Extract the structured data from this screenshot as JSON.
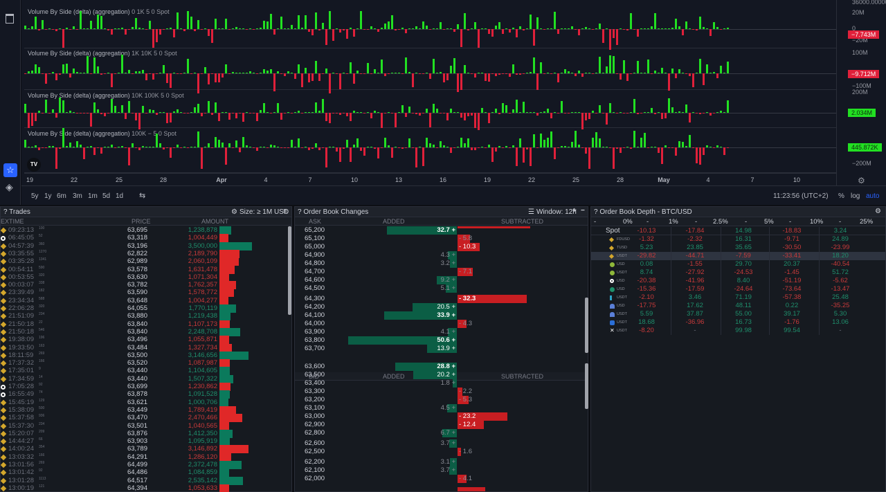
{
  "chart": {
    "panes": [
      {
        "title": "Volume By Side (delta) (aggregation)",
        "params": "0 1K 5 0 Spot",
        "axis": [
          "20M",
          "0",
          "−20M"
        ],
        "last": "−7.743M",
        "last_side": "sell"
      },
      {
        "title": "Volume By Side (delta) (aggregation)",
        "params": "1K 10K 5 0 Spot",
        "axis": [
          "100M",
          "−100M"
        ],
        "last": "−9.712M",
        "last_side": "sell"
      },
      {
        "title": "Volume By Side (delta) (aggregation)",
        "params": "10K 100K 5 0 Spot",
        "axis": [
          "200M"
        ],
        "last": "2.034M",
        "last_side": "buy"
      },
      {
        "title": "Volume By Side (delta) (aggregation)",
        "params": "100K − 5 0 Spot",
        "axis": [
          "−200M"
        ],
        "last": "445.872K",
        "last_side": "buy"
      }
    ],
    "top_axis_value": "36000.00000",
    "time_labels": [
      "19",
      "22",
      "25",
      "28",
      "Apr",
      "4",
      "7",
      "10",
      "13",
      "16",
      "19",
      "22",
      "25",
      "28",
      "May",
      "4",
      "7",
      "10"
    ],
    "ranges": [
      "5y",
      "1y",
      "6m",
      "3m",
      "1m",
      "5d",
      "1d"
    ],
    "clock": "11:23:56 (UTC+2)",
    "pct": "%",
    "log": "log",
    "auto": "auto",
    "logo": "TV"
  },
  "trades": {
    "title": "? Trades",
    "size_filter": "Size: ≥ 1M USD",
    "columns": [
      "EXTIME",
      "PRICE",
      "AMOUNT"
    ],
    "rows": [
      {
        "ex": "binance",
        "time": "09:23:13",
        "ms": "100",
        "price": "63,695",
        "amount": "1,238,878",
        "side": "buy",
        "v": 1.24
      },
      {
        "ex": "coinbase",
        "time": "06:45:05",
        "ms": "52",
        "price": "63,318",
        "amount": "1,004,449",
        "side": "sell",
        "v": 1.0
      },
      {
        "ex": "binance",
        "time": "04:57:39",
        "ms": "360",
        "price": "63,196",
        "amount": "3,500,000",
        "side": "buy",
        "v": 3.5
      },
      {
        "ex": "binance",
        "time": "03:35:55",
        "ms": "1270",
        "price": "62,822",
        "amount": "2,189,790",
        "side": "sell",
        "v": 2.19
      },
      {
        "ex": "binance",
        "time": "03:35:28",
        "ms": "1341",
        "price": "62,989",
        "amount": "2,060,109",
        "side": "sell",
        "v": 2.06
      },
      {
        "ex": "binance",
        "time": "00:54:11",
        "ms": "590",
        "price": "63,578",
        "amount": "1,631,478",
        "side": "sell",
        "v": 1.63
      },
      {
        "ex": "binance",
        "time": "00:53:55",
        "ms": "320",
        "price": "63,630",
        "amount": "1,071,304",
        "side": "sell",
        "v": 1.07
      },
      {
        "ex": "binance",
        "time": "00:03:07",
        "ms": "338",
        "price": "63,782",
        "amount": "1,762,357",
        "side": "sell",
        "v": 1.76
      },
      {
        "ex": "binance",
        "time": "23:39:49",
        "ms": "182",
        "price": "63,590",
        "amount": "1,578,772",
        "side": "sell",
        "v": 1.58
      },
      {
        "ex": "binance",
        "time": "23:34:34",
        "ms": "588",
        "price": "63,648",
        "amount": "1,004,277",
        "side": "sell",
        "v": 1.0
      },
      {
        "ex": "binance",
        "time": "22:06:28",
        "ms": "320",
        "price": "64,055",
        "amount": "1,770,119",
        "side": "buy",
        "v": 1.77
      },
      {
        "ex": "binance",
        "time": "21:51:09",
        "ms": "234",
        "price": "63,880",
        "amount": "1,219,438",
        "side": "buy",
        "v": 1.22
      },
      {
        "ex": "binance",
        "time": "21:50:18",
        "ms": "22",
        "price": "63,840",
        "amount": "1,107,173",
        "side": "sell",
        "v": 1.11
      },
      {
        "ex": "binance",
        "time": "21:50:18",
        "ms": "546",
        "price": "63,840",
        "amount": "2,248,708",
        "side": "buy",
        "v": 2.25
      },
      {
        "ex": "binance",
        "time": "19:38:09",
        "ms": "196",
        "price": "63,496",
        "amount": "1,055,871",
        "side": "sell",
        "v": 1.06
      },
      {
        "ex": "binance",
        "time": "19:33:50",
        "ms": "163",
        "price": "63,484",
        "amount": "1,327,734",
        "side": "sell",
        "v": 1.33
      },
      {
        "ex": "binance",
        "time": "18:11:59",
        "ms": "269",
        "price": "63,500",
        "amount": "3,146,656",
        "side": "buy",
        "v": 3.15
      },
      {
        "ex": "binance",
        "time": "17:37:32",
        "ms": "166",
        "price": "63,520",
        "amount": "1,087,987",
        "side": "sell",
        "v": 1.09
      },
      {
        "ex": "binance",
        "time": "17:35:01",
        "ms": "9",
        "price": "63,440",
        "amount": "1,104,605",
        "side": "buy",
        "v": 1.1
      },
      {
        "ex": "binance",
        "time": "17:34:59",
        "ms": "14",
        "price": "63,440",
        "amount": "1,507,322",
        "side": "buy",
        "v": 1.51
      },
      {
        "ex": "coinbase",
        "time": "17:05:28",
        "ms": "92",
        "price": "63,699",
        "amount": "1,230,862",
        "side": "sell",
        "v": 1.23
      },
      {
        "ex": "coinbase",
        "time": "16:55:49",
        "ms": "74",
        "price": "63,878",
        "amount": "1,091,528",
        "side": "buy",
        "v": 1.09
      },
      {
        "ex": "binance",
        "time": "15:45:19",
        "ms": "129",
        "price": "63,621",
        "amount": "1,000,706",
        "side": "buy",
        "v": 1.0
      },
      {
        "ex": "binance",
        "time": "15:38:09",
        "ms": "500",
        "price": "63,449",
        "amount": "1,789,419",
        "side": "sell",
        "v": 1.79
      },
      {
        "ex": "binance",
        "time": "15:37:58",
        "ms": "936",
        "price": "63,470",
        "amount": "2,470,466",
        "side": "sell",
        "v": 2.47
      },
      {
        "ex": "binance",
        "time": "15:37:30",
        "ms": "234",
        "price": "63,501",
        "amount": "1,040,565",
        "side": "sell",
        "v": 1.04
      },
      {
        "ex": "binance",
        "time": "15:20:07",
        "ms": "209",
        "price": "63,876",
        "amount": "1,412,350",
        "side": "buy",
        "v": 1.41
      },
      {
        "ex": "binance",
        "time": "14:44:27",
        "ms": "66",
        "price": "63,903",
        "amount": "1,095,919",
        "side": "buy",
        "v": 1.1
      },
      {
        "ex": "binance",
        "time": "14:00:24",
        "ms": "354",
        "price": "63,789",
        "amount": "3,146,892",
        "side": "sell",
        "v": 3.15
      },
      {
        "ex": "binance",
        "time": "13:03:32",
        "ms": "166",
        "price": "64,291",
        "amount": "1,286,120",
        "side": "sell",
        "v": 1.29
      },
      {
        "ex": "binance",
        "time": "13:01:56",
        "ms": "269",
        "price": "64,499",
        "amount": "2,372,478",
        "side": "buy",
        "v": 2.37
      },
      {
        "ex": "binance",
        "time": "13:01:42",
        "ms": "92",
        "price": "64,486",
        "amount": "1,084,859",
        "side": "buy",
        "v": 1.08
      },
      {
        "ex": "binance",
        "time": "13:01:28",
        "ms": "1113",
        "price": "64,517",
        "amount": "2,535,142",
        "side": "buy",
        "v": 2.54
      },
      {
        "ex": "binance",
        "time": "13:00:19",
        "ms": "121",
        "price": "64,394",
        "amount": "1,053,633",
        "side": "sell",
        "v": 1.05
      }
    ]
  },
  "obchanges": {
    "title": "? Order Book Changes",
    "window": "Window: 12h",
    "ask_columns": [
      "ASK",
      "ADDED",
      "SUBTRACTED"
    ],
    "bid_columns": [
      "BID",
      "ADDED",
      "SUBTRACTED"
    ],
    "asks": [
      {
        "price": "65,200",
        "label": "32.7 +",
        "v": 32.7,
        "type": "add"
      },
      {
        "price": "65,100",
        "label": "- 5.8",
        "v": 5.8,
        "type": "sub"
      },
      {
        "price": "65,000",
        "label": "- 10.3",
        "v": 10.3,
        "type": "sub"
      },
      {
        "price": "64,900",
        "label": "4.3 +",
        "v": 4.3,
        "type": "add"
      },
      {
        "price": "64,800",
        "label": "3.2 +",
        "v": 3.2,
        "type": "add"
      },
      {
        "price": "64,700",
        "label": "- 7.1",
        "v": 7.1,
        "type": "sub"
      },
      {
        "price": "64,600",
        "label": "9.2 +",
        "v": 9.2,
        "type": "add"
      },
      {
        "price": "64,500",
        "label": "5.1 +",
        "v": 5.1,
        "type": "add"
      },
      {
        "price": "64,300",
        "label": "- 32.3",
        "v": 32.3,
        "type": "sub",
        "gap": true
      },
      {
        "price": "64,200",
        "label": "20.5 +",
        "v": 20.5,
        "type": "add"
      },
      {
        "price": "64,100",
        "label": "33.9 +",
        "v": 33.9,
        "type": "add"
      },
      {
        "price": "64,000",
        "label": "- 4.3",
        "v": 4.3,
        "type": "sub"
      },
      {
        "price": "63,900",
        "label": "4.1 +",
        "v": 4.1,
        "type": "add"
      },
      {
        "price": "63,800",
        "label": "50.6 +",
        "v": 50.6,
        "type": "add"
      },
      {
        "price": "63,700",
        "label": "13.9 +",
        "v": 13.9,
        "type": "add"
      }
    ],
    "bids": [
      {
        "price": "63,600",
        "label": "28.8 +",
        "v": 28.8,
        "type": "add"
      },
      {
        "price": "63,500",
        "label": "20.2 +",
        "v": 20.2,
        "type": "add"
      },
      {
        "price": "63,400",
        "label": "1.8 +",
        "v": 1.8,
        "type": "add"
      },
      {
        "price": "63,300",
        "label": "- 2.2",
        "v": 2.2,
        "type": "sub"
      },
      {
        "price": "63,200",
        "label": "- 5.3",
        "v": 5.3,
        "type": "sub"
      },
      {
        "price": "63,100",
        "label": "4.5 +",
        "v": 4.5,
        "type": "add"
      },
      {
        "price": "63,000",
        "label": "- 23.2",
        "v": 23.2,
        "type": "sub"
      },
      {
        "price": "62,900",
        "label": "- 12.4",
        "v": 12.4,
        "type": "sub"
      },
      {
        "price": "62,800",
        "label": "6.7 +",
        "v": 6.7,
        "type": "add"
      },
      {
        "price": "62,600",
        "label": "3.7 +",
        "v": 3.7,
        "type": "add",
        "gap": true
      },
      {
        "price": "62,500",
        "label": "- 1.6",
        "v": 1.6,
        "type": "sub"
      },
      {
        "price": "62,200",
        "label": "3.1 +",
        "v": 3.1,
        "type": "add",
        "gap": true
      },
      {
        "price": "62,100",
        "label": "3.7 +",
        "v": 3.7,
        "type": "add"
      },
      {
        "price": "62,000",
        "label": "- 4.1",
        "v": 4.1,
        "type": "sub"
      }
    ]
  },
  "depth": {
    "title": "? Order Book Depth - BTC/USD",
    "header": [
      "-",
      "0%",
      "-",
      "1%",
      "-",
      "2.5%",
      "-",
      "5%",
      "-",
      "10%",
      "-",
      "25%"
    ],
    "rows": [
      {
        "label": "Spot",
        "ex": "",
        "vals": [
          "-10.13",
          "-17.84",
          "14.98",
          "-18.83",
          "3.24"
        ]
      },
      {
        "label": "FDUSD",
        "ex": "binance",
        "vals": [
          "-1.32",
          "-2.32",
          "16.31",
          "-9.71",
          "24.89"
        ]
      },
      {
        "label": "TUSD",
        "ex": "binance",
        "vals": [
          "5.23",
          "23.85",
          "35.65",
          "-30.50",
          "-23.99"
        ]
      },
      {
        "label": "USDT",
        "ex": "binance",
        "vals": [
          "-29.82",
          "-44.71",
          "-7.59",
          "-33.41",
          "18.20"
        ],
        "selected": true
      },
      {
        "label": "USD",
        "ex": "bitfinex",
        "vals": [
          "0.08",
          "-1.55",
          "29.70",
          "20.37",
          "-40.54"
        ]
      },
      {
        "label": "USDT",
        "ex": "bitfinex",
        "vals": [
          "8.74",
          "-27.92",
          "-24.53",
          "-1.45",
          "51.72"
        ]
      },
      {
        "label": "USD",
        "ex": "coinbase",
        "vals": [
          "-20.38",
          "-41.96",
          "8.40",
          "-51.19",
          "-5.62"
        ]
      },
      {
        "label": "USD",
        "ex": "bitstamp",
        "vals": [
          "-15.36",
          "-17.59",
          "-24.64",
          "-73.64",
          "-13.47"
        ]
      },
      {
        "label": "USDT",
        "ex": "bybit",
        "vals": [
          "-2.10",
          "3.46",
          "71.19",
          "-57.38",
          "25.48"
        ]
      },
      {
        "label": "USD",
        "ex": "kraken",
        "vals": [
          "-17.75",
          "17.62",
          "48.11",
          "0.22",
          "-35.25"
        ]
      },
      {
        "label": "USDT",
        "ex": "kraken",
        "vals": [
          "5.59",
          "37.87",
          "55.00",
          "39.17",
          "5.30"
        ]
      },
      {
        "label": "USDT",
        "ex": "kucoin",
        "vals": [
          "18.68",
          "-36.96",
          "16.73",
          "-1.76",
          "13.06"
        ]
      },
      {
        "label": "USDT",
        "ex": "okx",
        "vals": [
          "-8.20",
          "-",
          "99.98",
          "99.54",
          "-"
        ]
      }
    ]
  },
  "colors": {
    "buy": "#22e022",
    "sell": "#e0203a",
    "green_text": "#1f8f6c",
    "red_text": "#c93a3a"
  }
}
